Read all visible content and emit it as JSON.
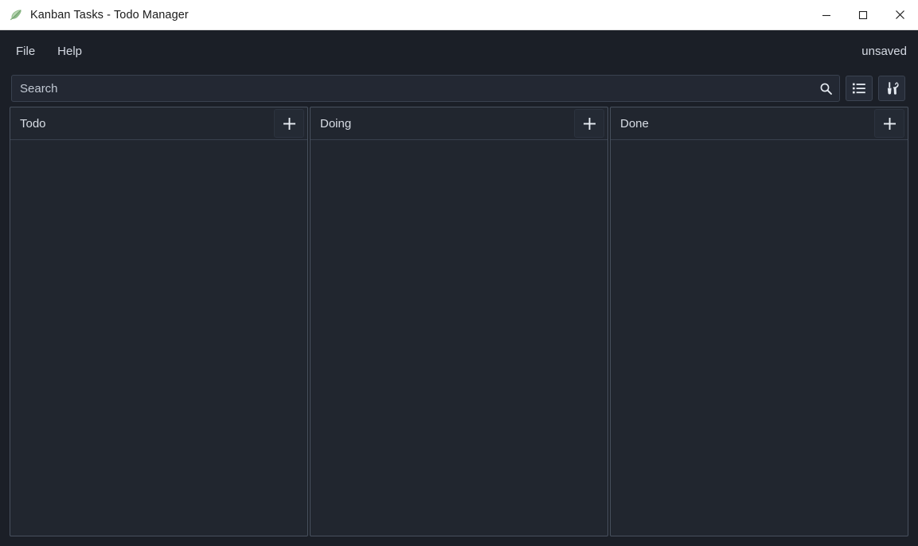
{
  "window": {
    "title": "Kanban Tasks - Todo Manager",
    "icon": "feather-icon",
    "controls": [
      {
        "name": "minimize-button",
        "icon": "minimize-icon",
        "label": "Minimize"
      },
      {
        "name": "maximize-button",
        "icon": "maximize-icon",
        "label": "Maximize"
      },
      {
        "name": "close-button",
        "icon": "close-icon",
        "label": "Close"
      }
    ]
  },
  "menubar": {
    "items": [
      {
        "label": "File"
      },
      {
        "label": "Help"
      }
    ],
    "status": "unsaved"
  },
  "toolbar": {
    "search": {
      "placeholder": "Search",
      "value": "",
      "icon": "search-icon"
    },
    "buttons": [
      {
        "name": "list-view-button",
        "icon": "list-icon",
        "label": "List view"
      },
      {
        "name": "settings-tools-button",
        "icon": "tools-icon",
        "label": "Tools"
      }
    ]
  },
  "board": {
    "add_icon": "plus-icon",
    "columns": [
      {
        "title": "Todo",
        "add_label": "+",
        "cards": []
      },
      {
        "title": "Doing",
        "add_label": "+",
        "cards": []
      },
      {
        "title": "Done",
        "add_label": "+",
        "cards": []
      }
    ]
  },
  "colors": {
    "window_background": "#1b1f27",
    "column_background": "#21262f",
    "column_border": "#48515f",
    "titlebar_background": "#ffffff",
    "text_primary": "#d8dde5",
    "accent_icon": "#8ab98a"
  }
}
